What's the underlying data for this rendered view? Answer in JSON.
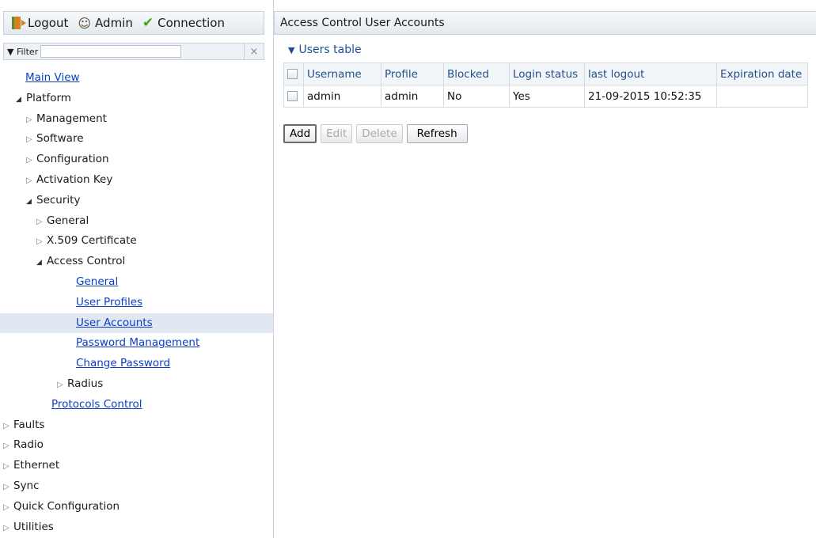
{
  "toolbar": {
    "logout": "Logout",
    "admin": "Admin",
    "connection": "Connection"
  },
  "filter": {
    "label": "Filter",
    "value": "",
    "clear": "×"
  },
  "tree": {
    "main_view": "Main View",
    "platform": "Platform",
    "management": "Management",
    "software": "Software",
    "configuration": "Configuration",
    "activation_key": "Activation Key",
    "security": "Security",
    "general": "General",
    "x509": "X.509 Certificate",
    "access_control": "Access Control",
    "ac_general": "General",
    "user_profiles": "User Profiles",
    "user_accounts": "User Accounts",
    "password_management": "Password Management",
    "change_password": "Change Password",
    "radius": "Radius",
    "protocols_control": "Protocols Control",
    "faults": "Faults",
    "radio": "Radio",
    "ethernet": "Ethernet",
    "sync": "Sync",
    "quick_configuration": "Quick Configuration",
    "utilities": "Utilities"
  },
  "main": {
    "title": "Access Control User Accounts",
    "section_title": "Users table",
    "table": {
      "headers": [
        "Username",
        "Profile",
        "Blocked",
        "Login status",
        "last logout",
        "Expiration date"
      ],
      "rows": [
        [
          "admin",
          "admin",
          "No",
          "Yes",
          "21-09-2015 10:52:35",
          ""
        ]
      ]
    },
    "buttons": {
      "add": "Add",
      "edit": "Edit",
      "delete": "Delete",
      "refresh": "Refresh"
    }
  }
}
